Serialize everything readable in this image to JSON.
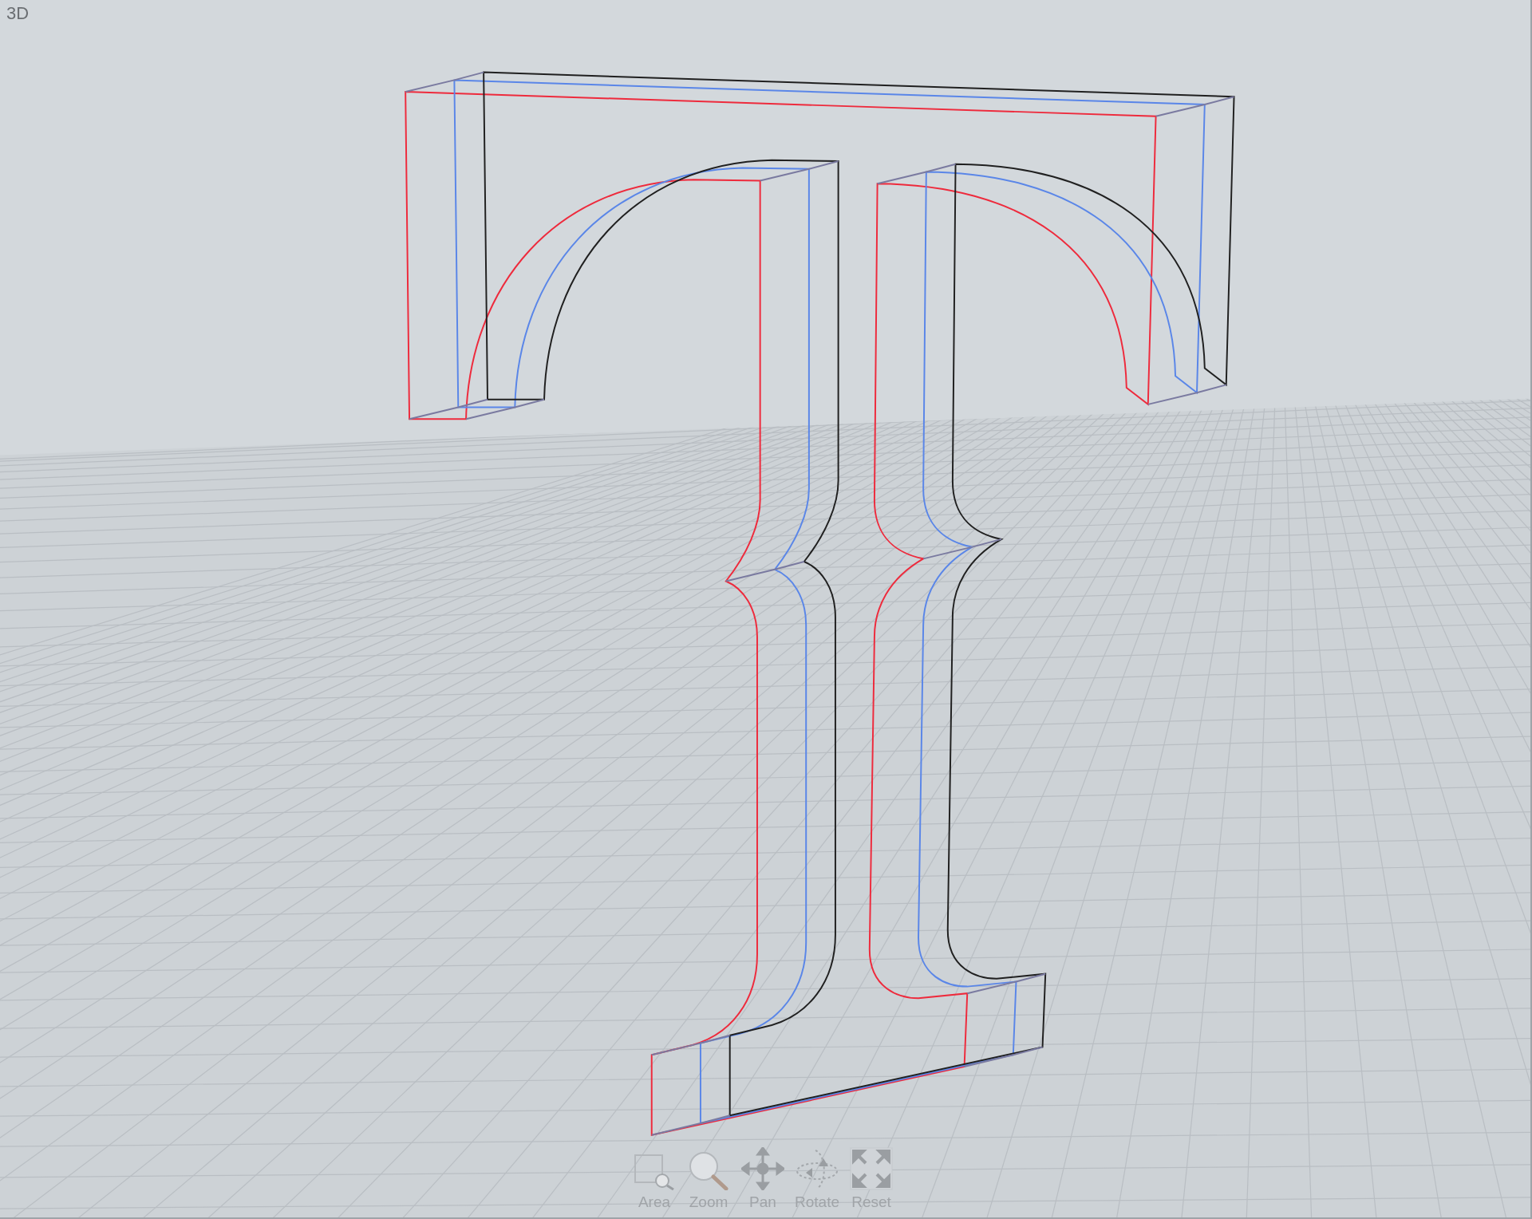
{
  "viewport": {
    "label": "3D"
  },
  "toolbar": [
    {
      "kind": "area",
      "label": "Area"
    },
    {
      "kind": "zoom",
      "label": "Zoom"
    },
    {
      "kind": "pan",
      "label": "Pan"
    },
    {
      "kind": "rotate",
      "label": "Rotate"
    },
    {
      "kind": "reset",
      "label": "Reset"
    }
  ]
}
